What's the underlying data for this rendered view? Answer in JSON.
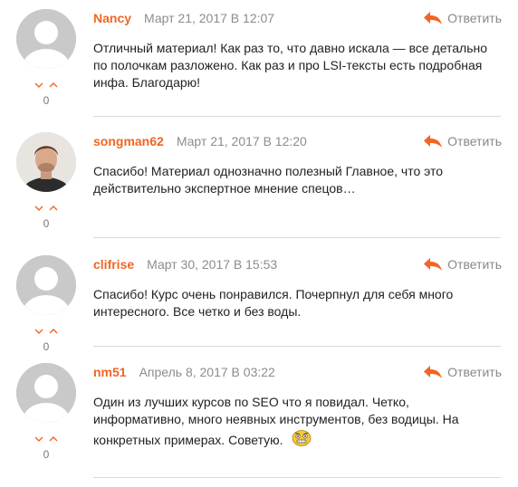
{
  "reply_label": "Ответить",
  "colors": {
    "author": "#f26522",
    "date": "#8c8c8c",
    "reply_icon": "#f26522",
    "vote_arrow": "#f26522"
  },
  "comments": [
    {
      "author": "Nancy",
      "date": "Март 21, 2017 В 12:07",
      "text": "Отличный материал! Как раз то, что давно искала — все детально по полочкам разложено. Как раз и про LSI-тексты есть подробная инфа. Благодарю!",
      "votes": "0",
      "avatar": "default-avatar"
    },
    {
      "author": "songman62",
      "date": "Март 21, 2017 В 12:20",
      "text": "Спасибо! Материал однозначно полезный Главное, что это действительно экспертное мнение спецов…",
      "votes": "0",
      "avatar": "user-photo"
    },
    {
      "author": "clifrise",
      "date": "Март 30, 2017 В 15:53",
      "text": "Спасибо! Курс очень понравился. Почерпнул для себя много интересного. Все четко и без воды.",
      "votes": "0",
      "avatar": "default-avatar"
    },
    {
      "author": "nm51",
      "date": "Апрель 8, 2017 В 03:22",
      "text": "Один из лучших курсов по SEO что я повидал. Четко, информативно, много неявных инструментов, без водицы. На конкретных примерах. Советую.",
      "votes": "0",
      "avatar": "default-avatar",
      "emoji": "thinking-face-emoji"
    }
  ]
}
